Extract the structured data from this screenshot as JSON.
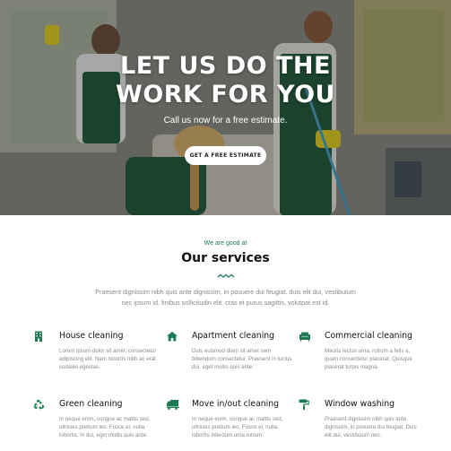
{
  "hero": {
    "title_line1": "LET US DO THE",
    "title_line2": "WORK FOR YOU",
    "subtitle": "Call us now for a free estimate.",
    "cta_label": "GET A FREE ESTIMATE"
  },
  "services_section": {
    "pre_title": "We are good at",
    "title": "Our services",
    "intro": "Praesent dignissim nibh quis ante dignissim, in posuere dui feugiat. duis elit dui, vestibulum nec ipsum id, finibus sollicitudin elit. cras et purus sagittis, volutpat est id."
  },
  "services": [
    {
      "icon": "building-icon",
      "title": "House cleaning",
      "desc": "Lorem ipsum dolor sit amet, consectetur adipiscing elit. Nam lobortis nibh ac erat sodales egestas."
    },
    {
      "icon": "home-icon",
      "title": "Apartment cleaning",
      "desc": "Duis euismod diam sit amet sem bibendum consectetur. Praesent in luctus dui, eget mollis quis ante."
    },
    {
      "icon": "sofa-icon",
      "title": "Commercial cleaning",
      "desc": "Mauris lectus urna, rutrum a felis a, quam consectetur placerat. Quisque placerat turpis magna."
    },
    {
      "icon": "recycle-icon",
      "title": "Green cleaning",
      "desc": "In neque enim, congue ac mattis sed, ultricies pretium leo. Fusce el, nulla lobortis. In dui, eget mollis quis ante."
    },
    {
      "icon": "truck-icon",
      "title": "Move in/out cleaning",
      "desc": "In neque enim, congue ac mattis sed, ultricies pretium leo. Fusce el, nulla lobortis interdum urna rutrum."
    },
    {
      "icon": "paint-roller-icon",
      "title": "Window washing",
      "desc": "Praesent dignissim nibh quis ante dignissim, in posuere dui feugiat. Duis elit dui, vestibulum nec."
    }
  ],
  "colors": {
    "accent": "#1d7a52",
    "text_dark": "#111111",
    "text_muted": "#888888"
  }
}
